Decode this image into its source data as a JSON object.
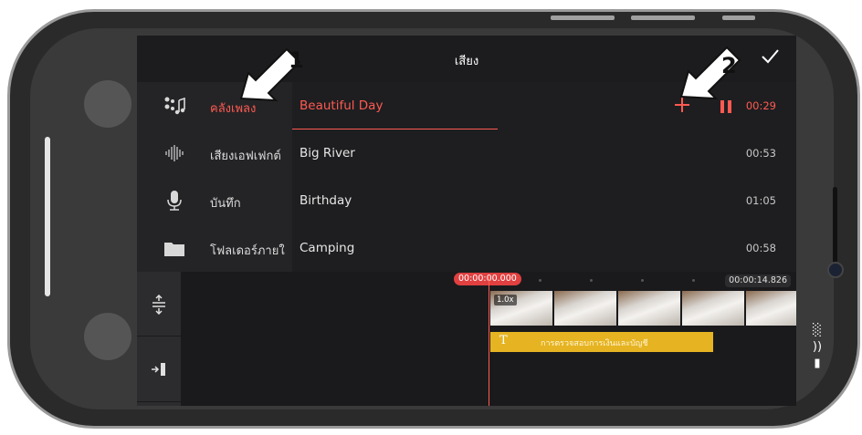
{
  "header": {
    "title": "เสียง"
  },
  "categories": [
    {
      "label": "คลังเพลง",
      "icon": "music-notes-icon",
      "active": true
    },
    {
      "label": "เสียงเอฟเฟกต์",
      "icon": "sound-wave-icon",
      "active": false
    },
    {
      "label": "บันทึก",
      "icon": "microphone-icon",
      "active": false
    },
    {
      "label": "โฟลเดอร์ภายใ",
      "icon": "folder-icon",
      "active": false
    }
  ],
  "tracks": [
    {
      "name": "Beautiful Day",
      "duration": "00:29",
      "active": true
    },
    {
      "name": "Big River",
      "duration": "00:53",
      "active": false
    },
    {
      "name": "Birthday",
      "duration": "01:05",
      "active": false
    },
    {
      "name": "Camping",
      "duration": "00:58",
      "active": false
    }
  ],
  "timeline": {
    "start_time": "00:00:00.000",
    "end_time": "00:00:14.826",
    "speed_badge": "1.0x",
    "text_clip_icon": "T",
    "text_clip_label": "การตรวจสอบการเงินและบัญชี"
  },
  "annotations": {
    "arrow1": "1",
    "arrow2": "2"
  },
  "status_icons": [
    "signal-icon",
    "wifi-icon",
    "battery-icon"
  ],
  "colors": {
    "accent": "#ff5a52",
    "text_clip": "#e6b422",
    "background": "#1c1c1e"
  }
}
